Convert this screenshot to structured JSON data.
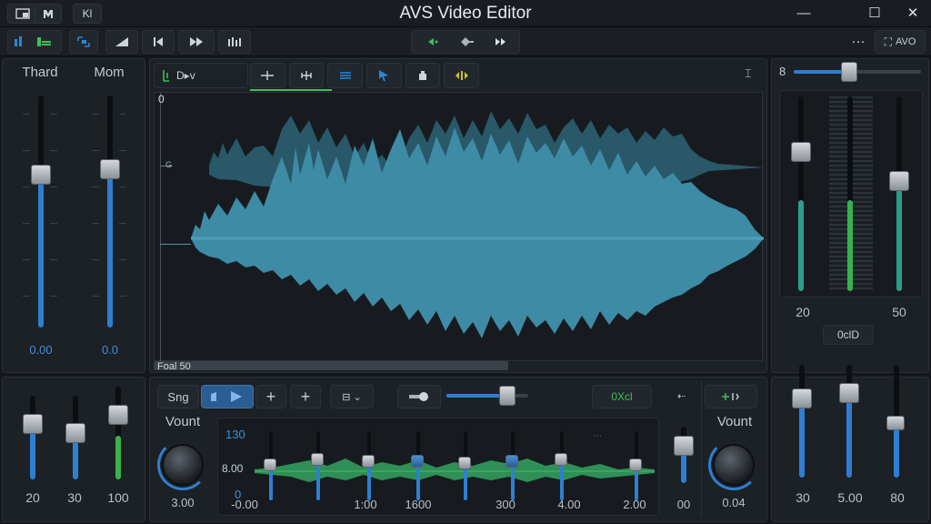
{
  "app": {
    "title": "AVS Video Editor"
  },
  "titlebar": {
    "btn3_label": "Kl",
    "right_label": "AVO"
  },
  "window_controls": {
    "minimize": "—",
    "maximize": "☐",
    "close": "✕",
    "more": "···"
  },
  "left_mixer": {
    "ch1_name": "Thard",
    "ch2_name": "Mom",
    "ch1_value": "0.00",
    "ch2_value": "0.0",
    "ch1_level": 0.72,
    "ch2_level": 0.7
  },
  "waveform_panel": {
    "tab_label": "D▸v",
    "ruler_top": "0",
    "ruler_mid": "G",
    "bottom_label": "Foal 50"
  },
  "right_mixer": {
    "top_labels": {
      "left": "20",
      "right": "50"
    },
    "readout": "0clD",
    "levels": [
      0.55,
      0.45,
      0.6
    ],
    "bottom_labels": [
      "30",
      "5.00",
      "80"
    ]
  },
  "bottom_left": {
    "labels": [
      "20",
      "30",
      "100"
    ]
  },
  "bottom_center": {
    "snap_label": "Sng",
    "green_readout": "0Xcl",
    "volume_label": "Vount",
    "volume_value": "3.00",
    "eq_top": "130",
    "eq_mid": "8.00",
    "eq_zero": "0",
    "eq_bottom": [
      "-0.00",
      "1:00",
      "1600",
      "300",
      "4.00",
      "2.00"
    ],
    "right_val": "00",
    "volume2_label": "Vount",
    "volume2_value": "0.04"
  }
}
